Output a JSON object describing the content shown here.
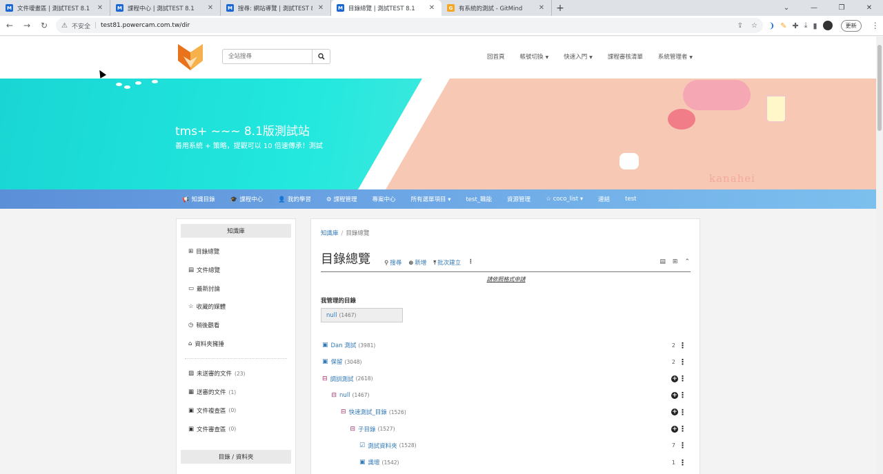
{
  "browser": {
    "tabs": [
      {
        "label": "文件璦畫區 | 測試TEST 8.1",
        "icon": "M",
        "active": false
      },
      {
        "label": "課程中心 | 測試TEST 8.1",
        "icon": "M",
        "active": false
      },
      {
        "label": "搜尋: 網站導覽 | 測試TEST 8.1",
        "icon": "M",
        "active": false
      },
      {
        "label": "目錄總覽 | 測試TEST 8.1",
        "icon": "M",
        "active": true
      },
      {
        "label": "有系統的測試 - GitMind",
        "icon": "G",
        "active": false
      }
    ],
    "insecure_label": "不安全",
    "url": "test81.powercam.com.tw/dir",
    "update_label": "更新"
  },
  "header": {
    "search_placeholder": "全站搜尋",
    "nav": [
      {
        "label": "回首頁",
        "dropdown": false
      },
      {
        "label": "帳號切換",
        "dropdown": true
      },
      {
        "label": "快速入門",
        "dropdown": true
      },
      {
        "label": "課程審核清單",
        "dropdown": false
      },
      {
        "label": "系統管理者",
        "dropdown": true
      }
    ]
  },
  "banner": {
    "title": "tms+ ~~~ 8.1版測試站",
    "subtitle": "善用系統 + 策略，提觀可以 10 倍速傳承！測試",
    "watermark": "kanahei"
  },
  "mainnav": [
    {
      "label": "知識目錄",
      "icon": "megaphone-icon",
      "glyph": "📢"
    },
    {
      "label": "課程中心",
      "icon": "graduation-cap-icon",
      "glyph": "🎓"
    },
    {
      "label": "我的學習",
      "icon": "user-icon",
      "glyph": "👤"
    },
    {
      "label": "課程管理",
      "icon": "gear-icon",
      "glyph": "⚙"
    },
    {
      "label": "專案中心",
      "icon": "",
      "glyph": ""
    },
    {
      "label": "所有選單項目",
      "icon": "",
      "glyph": "",
      "dropdown": true
    },
    {
      "label": "test_職能",
      "icon": "",
      "glyph": ""
    },
    {
      "label": "資源管理",
      "icon": "",
      "glyph": ""
    },
    {
      "label": "coco_list",
      "icon": "star-icon",
      "glyph": "☆",
      "dropdown": true
    },
    {
      "label": "連結",
      "icon": "",
      "glyph": ""
    },
    {
      "label": "test",
      "icon": "",
      "glyph": ""
    }
  ],
  "sidebar": {
    "heading": "知識庫",
    "items": [
      {
        "label": "目錄總覽",
        "icon": "sitemap-icon",
        "glyph": "⊞",
        "count": ""
      },
      {
        "label": "文件總覽",
        "icon": "document-icon",
        "glyph": "▤",
        "count": ""
      },
      {
        "label": "最新討論",
        "icon": "comment-icon",
        "glyph": "▭",
        "count": ""
      },
      {
        "label": "收藏的媒體",
        "icon": "star-icon",
        "glyph": "☆",
        "count": ""
      },
      {
        "label": "稍後觀看",
        "icon": "clock-icon",
        "glyph": "◷",
        "count": ""
      },
      {
        "label": "資料夾擁捶",
        "icon": "home-icon",
        "glyph": "⌂",
        "count": ""
      }
    ],
    "items2": [
      {
        "label": "未送審的文件",
        "icon": "file-edit-icon",
        "glyph": "▨",
        "count": "(23)"
      },
      {
        "label": "送審的文件",
        "icon": "list-icon",
        "glyph": "▦",
        "count": "(1)"
      },
      {
        "label": "文件複查區",
        "icon": "clipboard-icon",
        "glyph": "▣",
        "count": "(0)"
      },
      {
        "label": "文件審查區",
        "icon": "clipboard-icon",
        "glyph": "▣",
        "count": "(0)"
      }
    ],
    "heading2": "目錄 / 資料夾"
  },
  "main": {
    "breadcrumb": [
      "知識庫",
      "目錄總覽"
    ],
    "title": "目錄總覽",
    "actions": [
      {
        "label": "搜尋",
        "icon": "search-icon",
        "glyph": "⚲"
      },
      {
        "label": "新增",
        "icon": "plus-circle-icon",
        "glyph": "⊕"
      },
      {
        "label": "批次建立",
        "icon": "upload-icon",
        "glyph": "⤒"
      }
    ],
    "apply_link": "請依照格式申請",
    "managed_label": "我管理的目錄",
    "managed_item": {
      "label": "null",
      "count": "(1467)"
    },
    "tree": [
      {
        "label": "Dan 測試",
        "count": "(3981)",
        "level": 0,
        "icon": "folder-icon",
        "glyph": "▣",
        "right": "2",
        "plus": false
      },
      {
        "label": "保留",
        "count": "(3048)",
        "level": 0,
        "icon": "folder-icon",
        "glyph": "▣",
        "right": "2",
        "plus": false
      },
      {
        "label": "調訓測試",
        "count": "(2618)",
        "level": 0,
        "icon": "minus-square-icon",
        "glyph": "⊟",
        "right": "",
        "plus": true
      },
      {
        "label": "null",
        "count": "(1467)",
        "level": 1,
        "icon": "minus-square-icon",
        "glyph": "⊟",
        "right": "",
        "plus": true
      },
      {
        "label": "快速測試_目錄",
        "count": "(1526)",
        "level": 2,
        "icon": "minus-square-icon",
        "glyph": "⊟",
        "right": "",
        "plus": true
      },
      {
        "label": "子目錄",
        "count": "(1527)",
        "level": 3,
        "icon": "minus-square-icon",
        "glyph": "⊟",
        "right": "",
        "plus": true
      },
      {
        "label": "測試資料夾",
        "count": "(1528)",
        "level": 4,
        "icon": "check-folder-icon",
        "glyph": "☑",
        "right": "7",
        "plus": false
      },
      {
        "label": "識壇",
        "count": "(1542)",
        "level": 4,
        "icon": "folder-icon",
        "glyph": "▣",
        "right": "1",
        "plus": false
      }
    ]
  }
}
